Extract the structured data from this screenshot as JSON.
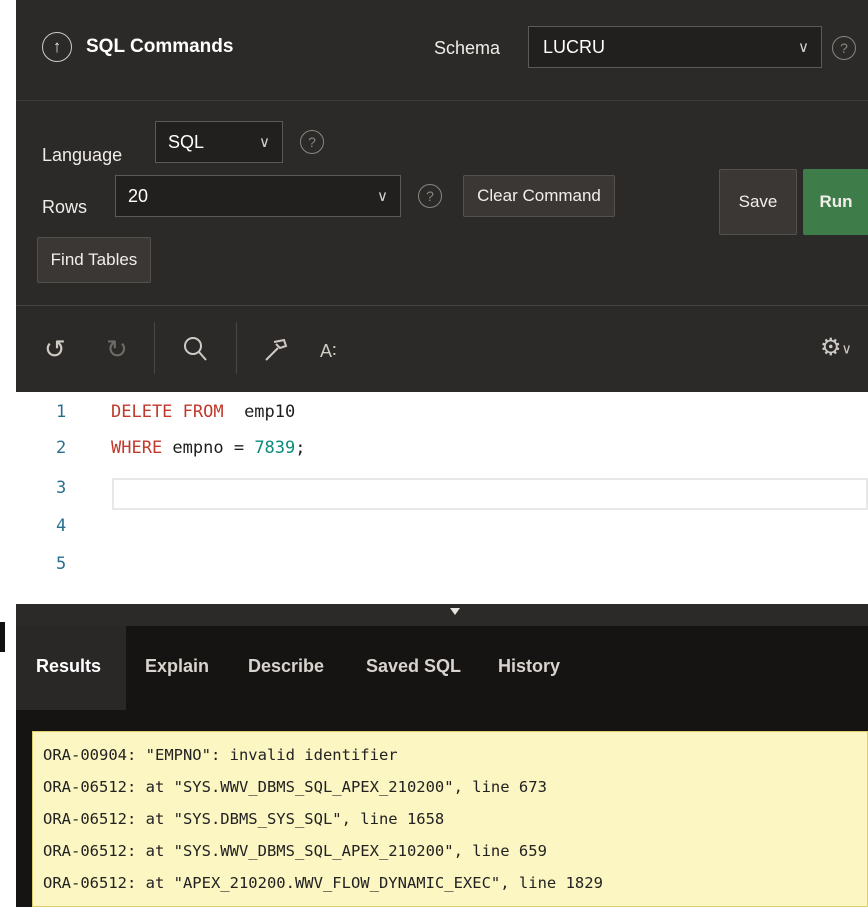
{
  "header": {
    "back_icon": "arrow-up-circle-icon",
    "title": "SQL Commands",
    "schema_label": "Schema",
    "schema_value": "LUCRU",
    "help_glyph": "?"
  },
  "toolbar": {
    "language_label": "Language",
    "language_value": "SQL",
    "rows_label": "Rows",
    "rows_value": "20",
    "clear_label": "Clear Command",
    "find_tables_label": "Find Tables",
    "save_label": "Save",
    "run_label": "Run",
    "help_glyph": "?",
    "run_color": "#3e7d4a"
  },
  "editor_toolbar": {
    "icons": [
      "undo-icon",
      "redo-icon",
      "search-icon",
      "hammer-icon",
      "autoformat-icon",
      "gear-icon"
    ],
    "format_label": "A∶"
  },
  "editor": {
    "line_numbers": [
      "1",
      "2",
      "3",
      "4",
      "5"
    ],
    "lines": [
      {
        "keyword": "DELETE FROM",
        "rest": "  emp10"
      },
      {
        "keyword": "WHERE",
        "rest": " empno = ",
        "number": "7839",
        "tail": ";"
      }
    ]
  },
  "result_tabs": [
    "Results",
    "Explain",
    "Describe",
    "Saved SQL",
    "History"
  ],
  "errors": [
    "ORA-00904: \"EMPNO\": invalid identifier",
    "ORA-06512: at \"SYS.WWV_DBMS_SQL_APEX_210200\", line 673",
    "ORA-06512: at \"SYS.DBMS_SYS_SQL\", line 1658",
    "ORA-06512: at \"SYS.WWV_DBMS_SQL_APEX_210200\", line 659",
    "ORA-06512: at \"APEX_210200.WWV_FLOW_DYNAMIC_EXEC\", line 1829"
  ]
}
